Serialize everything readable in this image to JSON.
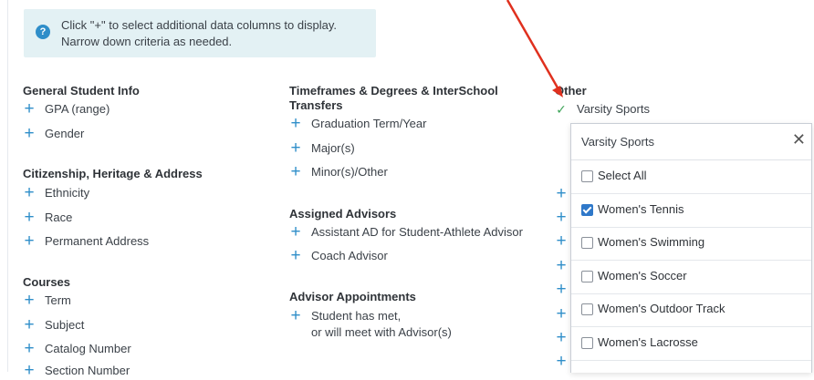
{
  "info": {
    "icon": "question-icon",
    "line1": "Click \"+\" to select additional data columns to display.",
    "line2": "Narrow down criteria as needed."
  },
  "col1": {
    "general": {
      "heading": "General Student Info",
      "items": [
        "GPA (range)",
        "Gender"
      ]
    },
    "citizenship": {
      "heading": "Citizenship, Heritage & Address",
      "items": [
        "Ethnicity",
        "Race",
        "Permanent Address"
      ]
    },
    "courses": {
      "heading": "Courses",
      "items": [
        "Term",
        "Subject",
        "Catalog Number",
        "Section Number"
      ]
    }
  },
  "col2": {
    "timeframes": {
      "heading_line1": "Timeframes & Degrees & InterSchool",
      "heading_line2": "Transfers",
      "items": [
        "Graduation Term/Year",
        "Major(s)",
        "Minor(s)/Other"
      ]
    },
    "advisors": {
      "heading": "Assigned Advisors",
      "items": [
        "Assistant AD for Student-Athlete Advisor",
        "Coach Advisor"
      ]
    },
    "appointments": {
      "heading": "Advisor Appointments",
      "item_line1": "Student has met,",
      "item_line2": "or will meet with Advisor(s)"
    }
  },
  "col3": {
    "heading": "Other",
    "selected_item": "Varsity Sports"
  },
  "dropdown": {
    "title": "Varsity Sports",
    "close_glyph": "✕",
    "options": [
      {
        "label": "Select All",
        "checked": false
      },
      {
        "label": "Women's Tennis",
        "checked": true
      },
      {
        "label": "Women's Swimming",
        "checked": false
      },
      {
        "label": "Women's Soccer",
        "checked": false
      },
      {
        "label": "Women's Outdoor Track",
        "checked": false
      },
      {
        "label": "Women's Lacrosse",
        "checked": false
      }
    ]
  },
  "colors": {
    "accent": "#2f8ec9",
    "check": "#3fa55a",
    "arrow": "#e0301e",
    "info_bg": "#e3f1f4"
  }
}
